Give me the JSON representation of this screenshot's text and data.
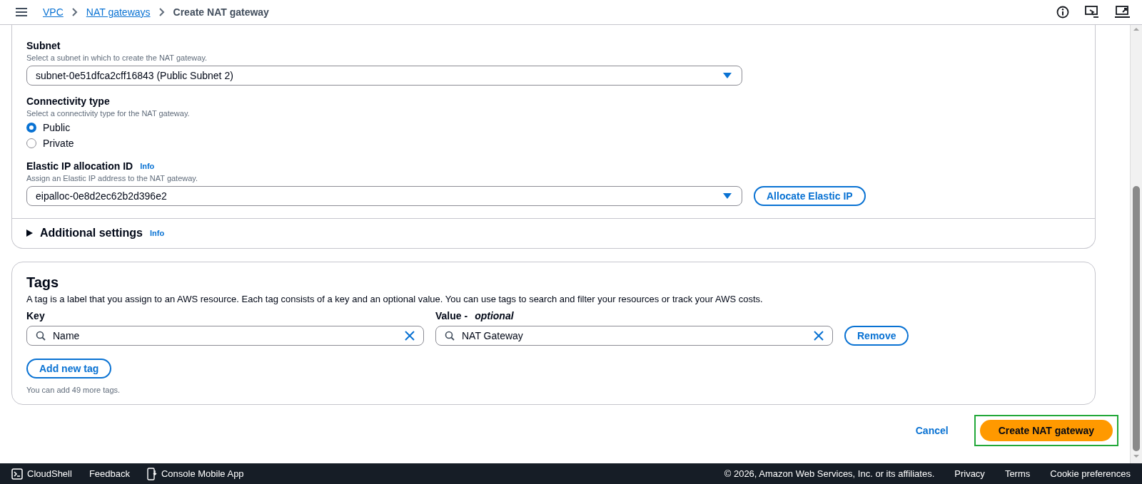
{
  "breadcrumbs": [
    {
      "label": "VPC",
      "kind": "link"
    },
    {
      "label": "NAT gateways",
      "kind": "link"
    },
    {
      "label": "Create NAT gateway",
      "kind": "current"
    }
  ],
  "subnet": {
    "label": "Subnet",
    "hint": "Select a subnet in which to create the NAT gateway.",
    "value": "subnet-0e51dfca2cff16843 (Public Subnet 2)"
  },
  "connectivity": {
    "label": "Connectivity type",
    "hint": "Select a connectivity type for the NAT gateway.",
    "options": [
      {
        "label": "Public",
        "selected": true
      },
      {
        "label": "Private",
        "selected": false
      }
    ]
  },
  "elastic_ip": {
    "label": "Elastic IP allocation ID",
    "info": "Info",
    "hint": "Assign an Elastic IP address to the NAT gateway.",
    "value": "eipalloc-0e8d2ec62b2d396e2",
    "button": "Allocate Elastic IP"
  },
  "additional_settings": {
    "label": "Additional settings",
    "info": "Info",
    "expanded": false
  },
  "tags": {
    "title": "Tags",
    "description": "A tag is a label that you assign to an AWS resource. Each tag consists of a key and an optional value. You can use tags to search and filter your resources or track your AWS costs.",
    "key_label": "Key",
    "value_label": "Value - *optional*",
    "rows": [
      {
        "key": "Name",
        "value": "NAT Gateway",
        "remove": "Remove"
      }
    ],
    "add_button": "Add new tag",
    "note": "You can add 49 more tags."
  },
  "actions": {
    "cancel": "Cancel",
    "create": "Create NAT gateway",
    "create_highlighted": true
  },
  "footer": {
    "left": [
      "CloudShell",
      "Feedback",
      "Console Mobile App"
    ],
    "copyright": "© 2026, Amazon Web Services, Inc. or its affiliates.",
    "links": [
      "Privacy",
      "Terms",
      "Cookie preferences"
    ]
  }
}
